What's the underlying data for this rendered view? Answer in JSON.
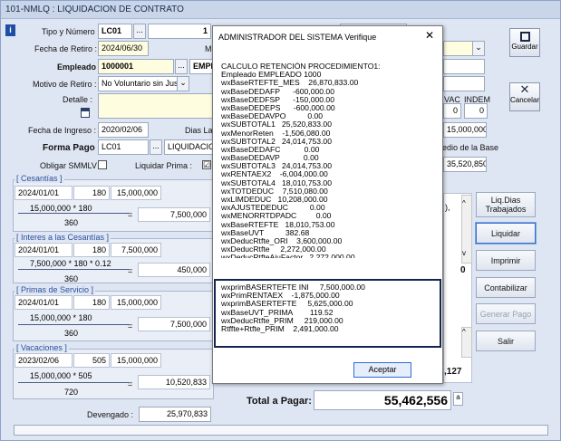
{
  "window": {
    "title": "101-NMLQ : LIQUIDACION DE CONTRATO"
  },
  "form": {
    "tipo_label": "Tipo y Número :",
    "tipo_value": "LC01",
    "numero_value": "1",
    "fecha_retiro_label": "Fecha de Retiro :",
    "fecha_retiro_value": "2024/06/30",
    "me_label": "Mé",
    "empleado_label": "Empleado :",
    "empleado_value": "1000001",
    "empleado_name": "EMPLI",
    "motivo_label": "Motivo de Retiro :",
    "motivo_value": "No Voluntario sin Justa",
    "detalle_label": "Detalle :",
    "fecha_ingreso_label": "Fecha de Ingreso :",
    "fecha_ingreso_value": "2020/02/06",
    "dias_lab_label": "Dias Lab",
    "forma_pago_label": "Forma Pago :",
    "forma_pago_value": "LC01",
    "forma_pago_name": "LIQUIDACION",
    "obligar_label": "Obligar SMMLV :",
    "liquidar_prima_label": "Liquidar Prima :",
    "liquidar_prima_check": "☑",
    "vac_label": "VAC",
    "indem_label": "INDEM",
    "vac_value": "0",
    "indem_value": "0",
    "salary_value": "15,000,000",
    "promedio_label": "edio de la Base",
    "promedio_value": "35,520,850"
  },
  "sections": {
    "cesantias": {
      "title": "[ Cesantías ]",
      "date": "2024/01/01",
      "days": "180",
      "base": "15,000,000",
      "formula": "15,000,000 * 180",
      "divisor": "360",
      "result": "7,500,000"
    },
    "intereses": {
      "title": "[ Interes a las Cesantías ]",
      "date": "2024/01/01",
      "days": "180",
      "base": "7,500,000",
      "formula": "7,500,000 * 180 * 0.12",
      "divisor": "360",
      "result": "450,000"
    },
    "primas": {
      "title": "[ Primas de Servicio ]",
      "date": "2024/01/01",
      "days": "180",
      "base": "15,000,000",
      "formula": "15,000,000 * 180",
      "divisor": "360",
      "result": "7,500,000"
    },
    "vacaciones": {
      "title": "[ Vacaciones ]",
      "date": "2023/02/06",
      "days": "505",
      "base": "15,000,000",
      "formula": "15,000,000 * 505",
      "divisor": "720",
      "result": "10,520,833"
    }
  },
  "side_values": {
    "zero": "0",
    "right_partial": ",127"
  },
  "totals": {
    "devengado_label": "Devengado :",
    "devengado_value": "25,970,833",
    "total_label": "Total a Pagar:",
    "total_value": "55,462,556",
    "total_suffix": "a"
  },
  "buttons": {
    "guardar": "Guardar",
    "cancelar": "Cancelar",
    "liq_dias": "Liq.Dias Trabajados",
    "liquidar": "Liquidar",
    "imprimir": "Imprimir",
    "contabilizar": "Contabilizar",
    "generar_pago": "Generar Pago",
    "salir": "Salir"
  },
  "dialog": {
    "title": "ADMINISTRADOR DEL SISTEMA Verifique",
    "close": "✕",
    "lines": [
      "CALCULO RETENCIÓN PROCEDIMIENTO1:",
      "Empleado EMPLEADO 1000",
      "wxBaseRTEFTE_MES    26,870,833.00",
      "wxBaseDEDAFP      -600,000.00",
      "wxBaseDEDFSP      -150,000.00",
      "wxBaseDEDEPS      -600,000.00",
      "wxBaseDEDAVPO          0.00",
      "wxSUBTOTAL1   25,520,833.00",
      "wxMenorReten    -1,506,080.00",
      "wxSUBTOTAL2   24,014,753.00",
      "wxBaseDEDAFC           0.00",
      "wxBaseDEDAVP           0.00",
      "wxSUBTOTAL3   24,014,753.00",
      "wxRENTAEX2    -6,004,000.00",
      "wxSUBTOTAL4   18,010,753.00",
      "wxTOTDEDUC    7,510,080.00",
      "wxLIMDEDUC   10,208,000.00",
      "wxAJUSTEDEDUC          0.00",
      "wxMENORRTDPADC         0.00",
      "wxBaseRTEFTE   18,010,753.00",
      "wxBaseUVT          382.68",
      "wxDeducRtfte_ORI    3,600,000.00",
      "wxDeducRtfte     2,272,000.00",
      "wxDeducRtfteAjuFactor   2,272,000.00"
    ],
    "highlight_lines": [
      "wxprimBASERTEFTE INI     7,500,000.00",
      "wxPrimRENTAEX    -1,875,000.00",
      "wxprimBASERTEFTE     5,625,000.00",
      "wxBaseUVT_PRIMA        119.52",
      "wxDeducRtfte_PRIM     219,000.00",
      "Rtffte+Rtfte_PRIM    2,491,000.00"
    ],
    "ok_button": "Aceptar"
  }
}
